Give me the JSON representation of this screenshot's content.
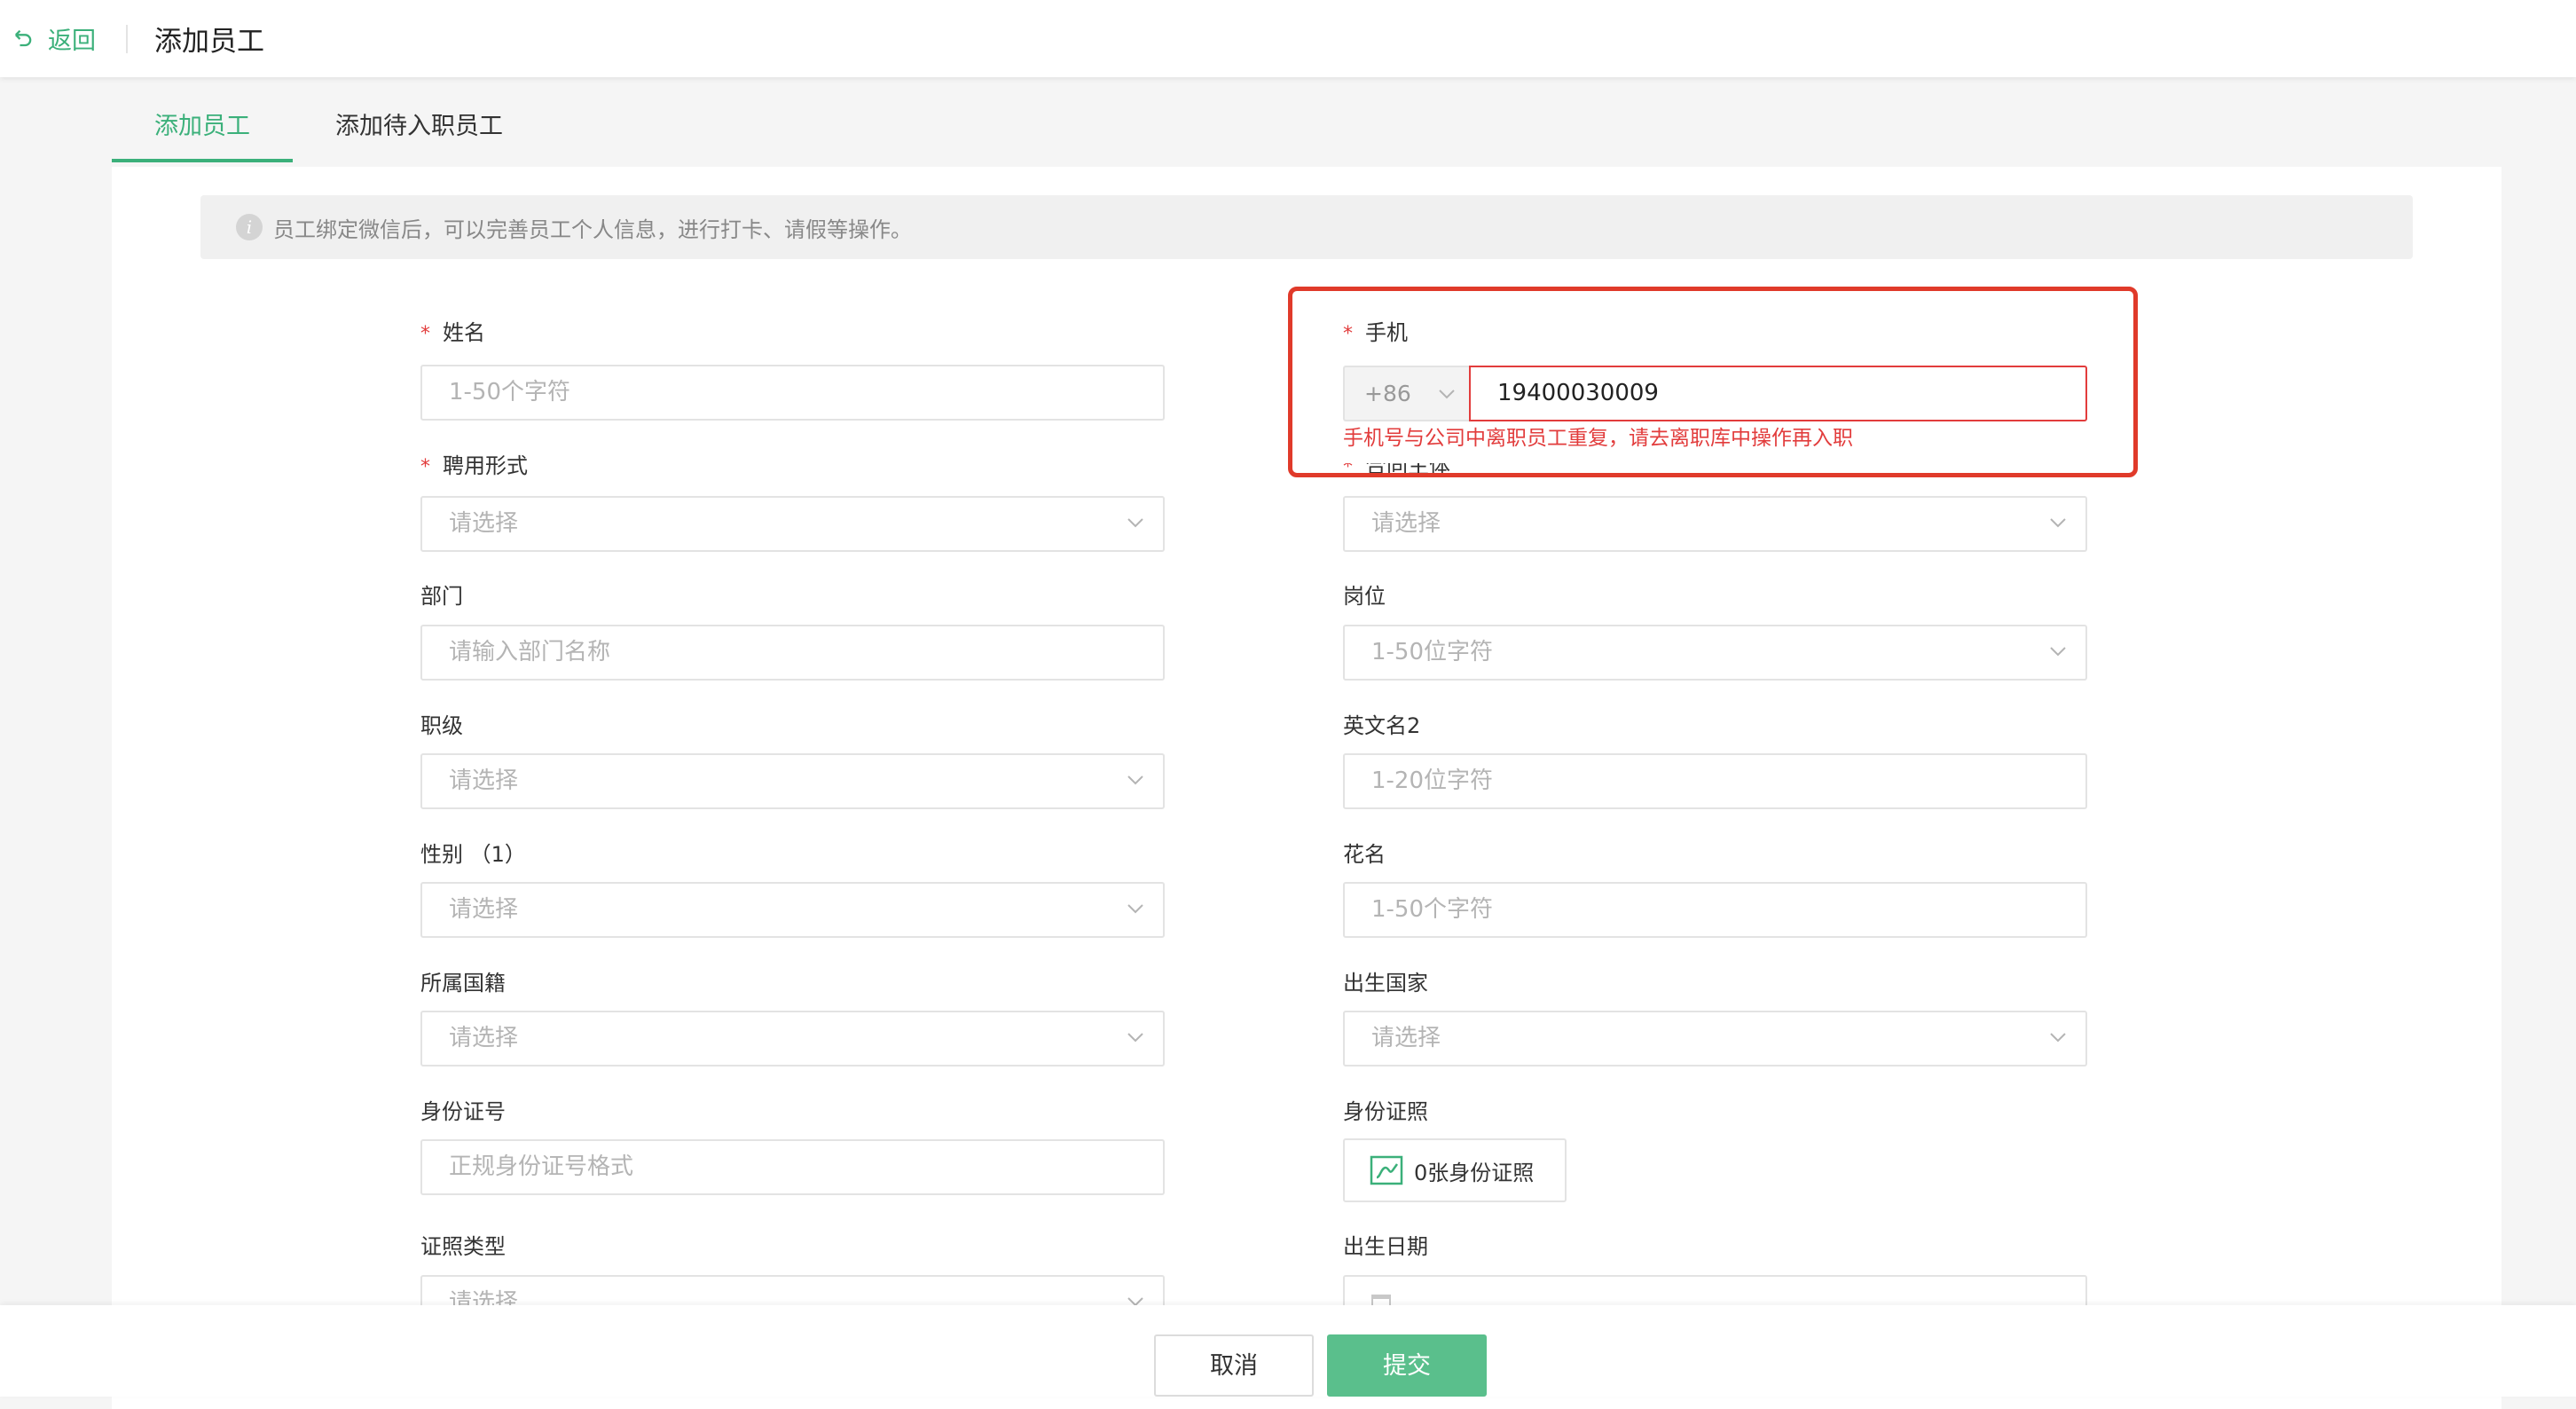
{
  "header": {
    "back_label": "返回",
    "title": "添加员工"
  },
  "tabs": [
    {
      "label": "添加员工",
      "active": true
    },
    {
      "label": "添加待入职员工",
      "active": false
    }
  ],
  "notice": "员工绑定微信后，可以完善员工个人信息，进行打卡、请假等操作。",
  "form": {
    "name": {
      "label": "姓名",
      "required": true,
      "placeholder": "1-50个字符"
    },
    "phone": {
      "label": "手机",
      "required": true,
      "country_code": "+86",
      "value": "19400030009",
      "error": "手机号与公司中离职员工重复，请去离职库中操作再入职"
    },
    "employment_type": {
      "label": "聘用形式",
      "required": true,
      "placeholder": "请选择"
    },
    "contract_entity": {
      "label": "合同主体",
      "required": true,
      "placeholder": "请选择"
    },
    "department": {
      "label": "部门",
      "placeholder": "请输入部门名称"
    },
    "position": {
      "label": "岗位",
      "placeholder": "1-50位字符"
    },
    "rank": {
      "label": "职级",
      "placeholder": "请选择"
    },
    "english_name": {
      "label": "英文名2",
      "placeholder": "1-20位字符"
    },
    "gender": {
      "label": "性别 （1）",
      "placeholder": "请选择"
    },
    "nickname": {
      "label": "花名",
      "placeholder": "1-50个字符"
    },
    "nationality": {
      "label": "所属国籍",
      "placeholder": "请选择"
    },
    "birth_country": {
      "label": "出生国家",
      "placeholder": "请选择"
    },
    "id_number": {
      "label": "身份证号",
      "placeholder": "正规身份证号格式"
    },
    "id_photo": {
      "label": "身份证照",
      "button": "0张身份证照"
    },
    "id_type": {
      "label": "证照类型",
      "placeholder": "请选择"
    },
    "birth_date": {
      "label": "出生日期",
      "placeholder": ""
    }
  },
  "footer": {
    "cancel_label": "取消",
    "submit_label": "提交"
  },
  "colors": {
    "accent": "#3bb07a",
    "error": "#e23c3c",
    "submit": "#5abf8c"
  }
}
